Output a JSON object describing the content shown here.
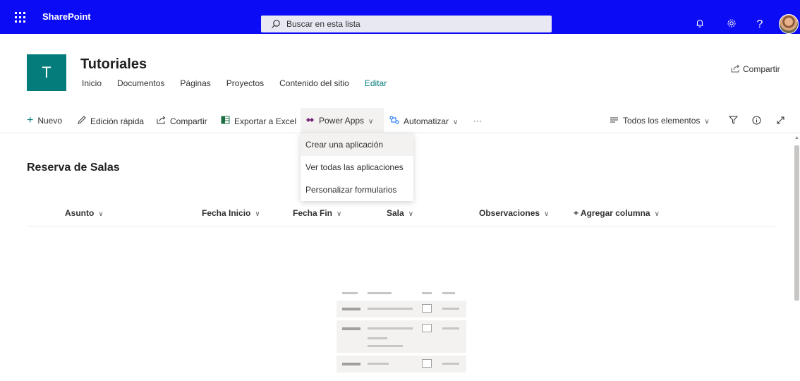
{
  "suitebar": {
    "brand": "SharePoint",
    "search_placeholder": "Buscar en esta lista",
    "icons": [
      "bell-icon",
      "gear-icon",
      "help-icon"
    ],
    "help_glyph": "?"
  },
  "site": {
    "logo_letter": "T",
    "title": "Tutoriales",
    "nav": [
      "Inicio",
      "Documentos",
      "Páginas",
      "Proyectos",
      "Contenido del sitio",
      "Editar"
    ],
    "share": "Compartir"
  },
  "commandbar": {
    "new": "Nuevo",
    "quick_edit": "Edición rápida",
    "share": "Compartir",
    "export": "Exportar a Excel",
    "power_apps": "Power Apps",
    "automate": "Automatizar",
    "more": "···",
    "view": "Todos los elementos"
  },
  "dropdown": {
    "items": [
      "Crear una aplicación",
      "Ver todas las aplicaciones",
      "Personalizar formularios"
    ]
  },
  "list": {
    "title": "Reserva de Salas",
    "columns": [
      "Asunto",
      "Fecha Inicio",
      "Fecha Fin",
      "Sala",
      "Observaciones",
      "+ Agregar columna"
    ]
  },
  "colors": {
    "suitebar": "#0b0bf5",
    "accent": "#037c7b"
  }
}
